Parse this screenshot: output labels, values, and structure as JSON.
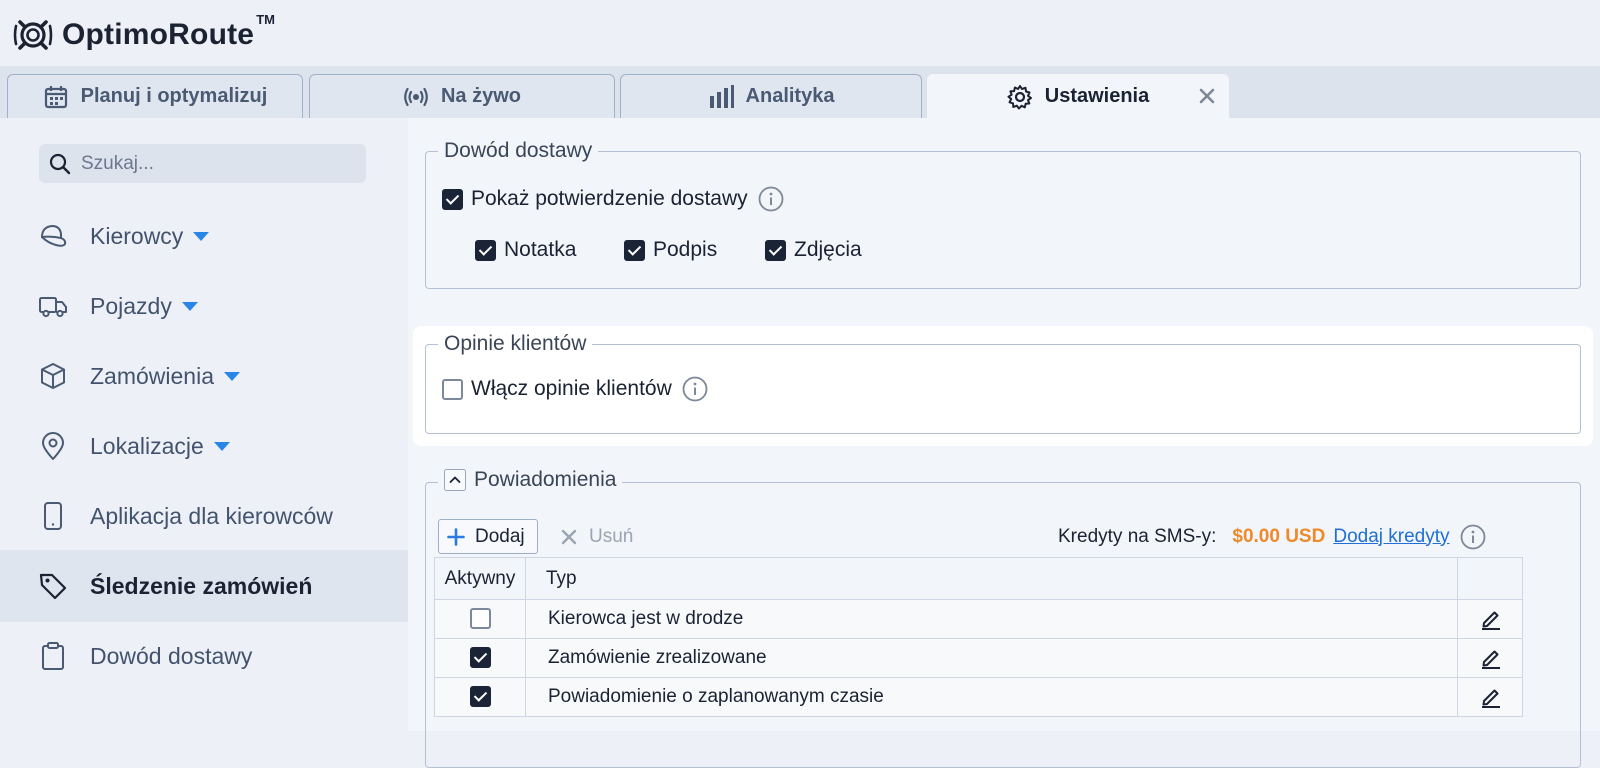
{
  "app": {
    "name": "OptimoRoute",
    "trademark": "TM"
  },
  "tabs": [
    {
      "label": "Planuj i optymalizuj",
      "icon": "calendar-icon",
      "active": false
    },
    {
      "label": "Na żywo",
      "icon": "broadcast-icon",
      "active": false
    },
    {
      "label": "Analityka",
      "icon": "bar-chart-icon",
      "active": false
    },
    {
      "label": "Ustawienia",
      "icon": "gear-icon",
      "active": true,
      "closable": true
    }
  ],
  "sidebar": {
    "search_placeholder": "Szukaj...",
    "items": [
      {
        "label": "Kierowcy",
        "icon": "driver-cap-icon",
        "has_caret": true
      },
      {
        "label": "Pojazdy",
        "icon": "truck-icon",
        "has_caret": true
      },
      {
        "label": "Zamówienia",
        "icon": "box-icon",
        "has_caret": true
      },
      {
        "label": "Lokalizacje",
        "icon": "location-pin-icon",
        "has_caret": true
      },
      {
        "label": "Aplikacja dla kierowców",
        "icon": "phone-icon",
        "has_caret": false
      },
      {
        "label": "Śledzenie zamówień",
        "icon": "tag-icon",
        "has_caret": false,
        "active": true
      },
      {
        "label": "Dowód dostawy",
        "icon": "clipboard-icon",
        "has_caret": false
      }
    ]
  },
  "proof_of_delivery": {
    "legend": "Dowód dostawy",
    "show_confirmation": {
      "label": "Pokaż potwierdzenie dostawy",
      "checked": true
    },
    "options": [
      {
        "label": "Notatka",
        "checked": true
      },
      {
        "label": "Podpis",
        "checked": true
      },
      {
        "label": "Zdjęcia",
        "checked": true
      }
    ]
  },
  "customer_feedback": {
    "legend": "Opinie klientów",
    "enable": {
      "label": "Włącz opinie klientów",
      "checked": false
    }
  },
  "notifications": {
    "legend": "Powiadomienia",
    "add_label": "Dodaj",
    "delete_label": "Usuń",
    "credits_label": "Kredyty na SMS-y:",
    "credits_value": "$0.00 USD",
    "add_credits_label": "Dodaj kredyty",
    "columns": [
      "Aktywny",
      "Typ",
      ""
    ],
    "rows": [
      {
        "active": false,
        "type": "Kierowca jest w drodze"
      },
      {
        "active": true,
        "type": "Zamówienie zrealizowane"
      },
      {
        "active": true,
        "type": "Powiadomienie o zaplanowanym czasie"
      }
    ]
  },
  "colors": {
    "accent": "#2a86e6",
    "credits_amount": "#ee8a2a",
    "link": "#1f6fd6",
    "dark": "#1b2436"
  }
}
